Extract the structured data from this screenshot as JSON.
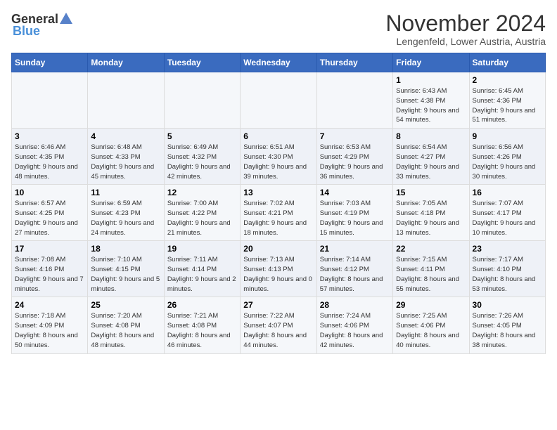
{
  "logo": {
    "text_general": "General",
    "text_blue": "Blue"
  },
  "title": "November 2024",
  "subtitle": "Lengenfeld, Lower Austria, Austria",
  "days_of_week": [
    "Sunday",
    "Monday",
    "Tuesday",
    "Wednesday",
    "Thursday",
    "Friday",
    "Saturday"
  ],
  "weeks": [
    [
      {
        "day": "",
        "detail": ""
      },
      {
        "day": "",
        "detail": ""
      },
      {
        "day": "",
        "detail": ""
      },
      {
        "day": "",
        "detail": ""
      },
      {
        "day": "",
        "detail": ""
      },
      {
        "day": "1",
        "detail": "Sunrise: 6:43 AM\nSunset: 4:38 PM\nDaylight: 9 hours and 54 minutes."
      },
      {
        "day": "2",
        "detail": "Sunrise: 6:45 AM\nSunset: 4:36 PM\nDaylight: 9 hours and 51 minutes."
      }
    ],
    [
      {
        "day": "3",
        "detail": "Sunrise: 6:46 AM\nSunset: 4:35 PM\nDaylight: 9 hours and 48 minutes."
      },
      {
        "day": "4",
        "detail": "Sunrise: 6:48 AM\nSunset: 4:33 PM\nDaylight: 9 hours and 45 minutes."
      },
      {
        "day": "5",
        "detail": "Sunrise: 6:49 AM\nSunset: 4:32 PM\nDaylight: 9 hours and 42 minutes."
      },
      {
        "day": "6",
        "detail": "Sunrise: 6:51 AM\nSunset: 4:30 PM\nDaylight: 9 hours and 39 minutes."
      },
      {
        "day": "7",
        "detail": "Sunrise: 6:53 AM\nSunset: 4:29 PM\nDaylight: 9 hours and 36 minutes."
      },
      {
        "day": "8",
        "detail": "Sunrise: 6:54 AM\nSunset: 4:27 PM\nDaylight: 9 hours and 33 minutes."
      },
      {
        "day": "9",
        "detail": "Sunrise: 6:56 AM\nSunset: 4:26 PM\nDaylight: 9 hours and 30 minutes."
      }
    ],
    [
      {
        "day": "10",
        "detail": "Sunrise: 6:57 AM\nSunset: 4:25 PM\nDaylight: 9 hours and 27 minutes."
      },
      {
        "day": "11",
        "detail": "Sunrise: 6:59 AM\nSunset: 4:23 PM\nDaylight: 9 hours and 24 minutes."
      },
      {
        "day": "12",
        "detail": "Sunrise: 7:00 AM\nSunset: 4:22 PM\nDaylight: 9 hours and 21 minutes."
      },
      {
        "day": "13",
        "detail": "Sunrise: 7:02 AM\nSunset: 4:21 PM\nDaylight: 9 hours and 18 minutes."
      },
      {
        "day": "14",
        "detail": "Sunrise: 7:03 AM\nSunset: 4:19 PM\nDaylight: 9 hours and 15 minutes."
      },
      {
        "day": "15",
        "detail": "Sunrise: 7:05 AM\nSunset: 4:18 PM\nDaylight: 9 hours and 13 minutes."
      },
      {
        "day": "16",
        "detail": "Sunrise: 7:07 AM\nSunset: 4:17 PM\nDaylight: 9 hours and 10 minutes."
      }
    ],
    [
      {
        "day": "17",
        "detail": "Sunrise: 7:08 AM\nSunset: 4:16 PM\nDaylight: 9 hours and 7 minutes."
      },
      {
        "day": "18",
        "detail": "Sunrise: 7:10 AM\nSunset: 4:15 PM\nDaylight: 9 hours and 5 minutes."
      },
      {
        "day": "19",
        "detail": "Sunrise: 7:11 AM\nSunset: 4:14 PM\nDaylight: 9 hours and 2 minutes."
      },
      {
        "day": "20",
        "detail": "Sunrise: 7:13 AM\nSunset: 4:13 PM\nDaylight: 9 hours and 0 minutes."
      },
      {
        "day": "21",
        "detail": "Sunrise: 7:14 AM\nSunset: 4:12 PM\nDaylight: 8 hours and 57 minutes."
      },
      {
        "day": "22",
        "detail": "Sunrise: 7:15 AM\nSunset: 4:11 PM\nDaylight: 8 hours and 55 minutes."
      },
      {
        "day": "23",
        "detail": "Sunrise: 7:17 AM\nSunset: 4:10 PM\nDaylight: 8 hours and 53 minutes."
      }
    ],
    [
      {
        "day": "24",
        "detail": "Sunrise: 7:18 AM\nSunset: 4:09 PM\nDaylight: 8 hours and 50 minutes."
      },
      {
        "day": "25",
        "detail": "Sunrise: 7:20 AM\nSunset: 4:08 PM\nDaylight: 8 hours and 48 minutes."
      },
      {
        "day": "26",
        "detail": "Sunrise: 7:21 AM\nSunset: 4:08 PM\nDaylight: 8 hours and 46 minutes."
      },
      {
        "day": "27",
        "detail": "Sunrise: 7:22 AM\nSunset: 4:07 PM\nDaylight: 8 hours and 44 minutes."
      },
      {
        "day": "28",
        "detail": "Sunrise: 7:24 AM\nSunset: 4:06 PM\nDaylight: 8 hours and 42 minutes."
      },
      {
        "day": "29",
        "detail": "Sunrise: 7:25 AM\nSunset: 4:06 PM\nDaylight: 8 hours and 40 minutes."
      },
      {
        "day": "30",
        "detail": "Sunrise: 7:26 AM\nSunset: 4:05 PM\nDaylight: 8 hours and 38 minutes."
      }
    ]
  ]
}
